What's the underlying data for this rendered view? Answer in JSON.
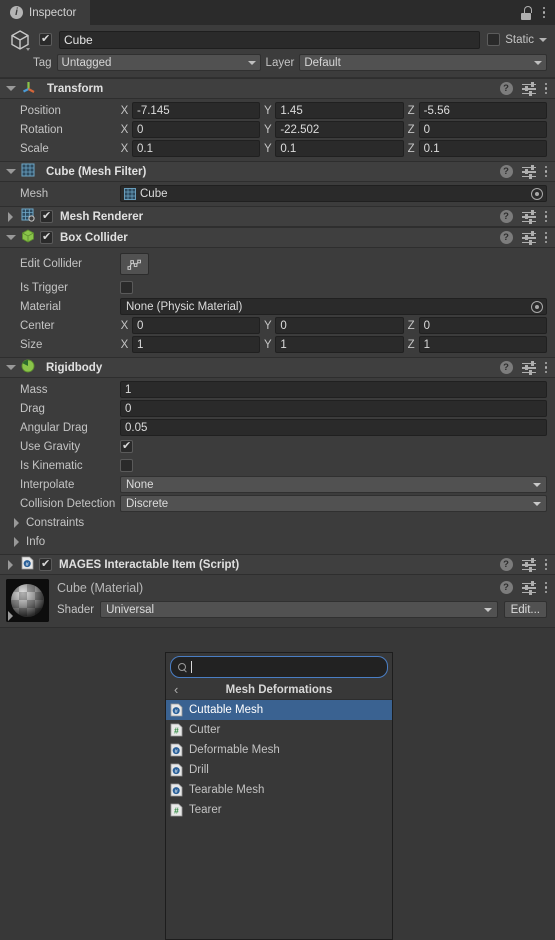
{
  "window": {
    "tab_label": "Inspector",
    "tab_icon": "info-icon",
    "lock_icon": "lock-open-icon",
    "menu_icon": "kebab-menu-icon"
  },
  "object_header": {
    "icon": "cube-gameobject-icon",
    "enabled": true,
    "name": "Cube",
    "static_label": "Static",
    "static_checked": false,
    "tag_label": "Tag",
    "tag_value": "Untagged",
    "layer_label": "Layer",
    "layer_value": "Default"
  },
  "components": [
    {
      "id": "transform",
      "title": "Transform",
      "icon": "transform-axis-icon",
      "expanded": true,
      "has_checkbox": false,
      "rows": [
        {
          "label": "Position",
          "type": "vector3",
          "x": "-7.145",
          "y": "1.45",
          "z": "-5.56"
        },
        {
          "label": "Rotation",
          "type": "vector3",
          "x": "0",
          "y": "-22.502",
          "z": "0"
        },
        {
          "label": "Scale",
          "type": "vector3",
          "x": "0.1",
          "y": "0.1",
          "z": "0.1"
        }
      ]
    },
    {
      "id": "mesh-filter",
      "title": "Cube (Mesh Filter)",
      "icon": "mesh-filter-icon",
      "expanded": true,
      "has_checkbox": false,
      "rows": [
        {
          "label": "Mesh",
          "type": "object",
          "value": "Cube",
          "value_icon": "mesh-icon"
        }
      ]
    },
    {
      "id": "mesh-renderer",
      "title": "Mesh Renderer",
      "icon": "mesh-renderer-icon",
      "expanded": false,
      "has_checkbox": true,
      "checked": true,
      "rows": []
    },
    {
      "id": "box-collider",
      "title": "Box Collider",
      "icon": "box-collider-icon",
      "expanded": true,
      "has_checkbox": true,
      "checked": true,
      "rows": [
        {
          "label": "Edit Collider",
          "type": "button",
          "button_icon": "edit-collider-icon"
        },
        {
          "label": "Is Trigger",
          "type": "checkbox",
          "checked": false
        },
        {
          "label": "Material",
          "type": "object",
          "value": "None (Physic Material)"
        },
        {
          "label": "Center",
          "type": "vector3",
          "x": "0",
          "y": "0",
          "z": "0"
        },
        {
          "label": "Size",
          "type": "vector3",
          "x": "1",
          "y": "1",
          "z": "1"
        }
      ]
    },
    {
      "id": "rigidbody",
      "title": "Rigidbody",
      "icon": "rigidbody-icon",
      "expanded": true,
      "has_checkbox": false,
      "rows": [
        {
          "label": "Mass",
          "type": "text",
          "value": "1"
        },
        {
          "label": "Drag",
          "type": "text",
          "value": "0"
        },
        {
          "label": "Angular Drag",
          "type": "text",
          "value": "0.05"
        },
        {
          "label": "Use Gravity",
          "type": "checkbox",
          "checked": true
        },
        {
          "label": "Is Kinematic",
          "type": "checkbox",
          "checked": false
        },
        {
          "label": "Interpolate",
          "type": "dropdown",
          "value": "None"
        },
        {
          "label": "Collision Detection",
          "type": "dropdown",
          "value": "Discrete"
        },
        {
          "label": "Constraints",
          "type": "foldout"
        },
        {
          "label": "Info",
          "type": "foldout"
        }
      ]
    },
    {
      "id": "mages-interactable-item",
      "title": "MAGES Interactable Item (Script)",
      "icon": "csharp-script-icon",
      "expanded": false,
      "has_checkbox": true,
      "checked": true,
      "rows": []
    }
  ],
  "material": {
    "title": "Cube (Material)",
    "preview_icon": "material-sphere-preview",
    "shader_label": "Shader",
    "shader_value": "Universal",
    "edit_label": "Edit...",
    "help_icon": "help-icon",
    "preset_icon": "preset-icon",
    "menu_icon": "kebab-menu-icon"
  },
  "popup": {
    "search_placeholder": "",
    "search_value": "",
    "search_icon": "search-icon",
    "back_icon": "chevron-left-icon",
    "header": "Mesh Deformations",
    "items": [
      {
        "label": "Cuttable Mesh",
        "icon": "csharp-script-icon",
        "selected": true
      },
      {
        "label": "Cutter",
        "icon": "hash-script-icon",
        "selected": false
      },
      {
        "label": "Deformable Mesh",
        "icon": "csharp-script-icon",
        "selected": false
      },
      {
        "label": "Drill",
        "icon": "csharp-script-icon",
        "selected": false
      },
      {
        "label": "Tearable Mesh",
        "icon": "csharp-script-icon",
        "selected": false
      },
      {
        "label": "Tearer",
        "icon": "hash-script-icon",
        "selected": false
      }
    ]
  },
  "colors": {
    "panel_bg": "#3c3c3c",
    "window_bg": "#383838",
    "header_bg": "#3f3f3f",
    "field_bg": "#2a2a2a",
    "dropdown_bg": "#515151",
    "selection_blue": "#3a6291",
    "focus_blue": "#4a7ec4",
    "text": "#c4c4c4"
  }
}
